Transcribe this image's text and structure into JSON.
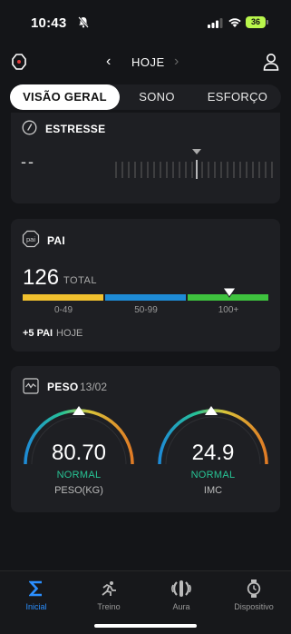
{
  "status_bar": {
    "time": "10:43",
    "battery": "36"
  },
  "header": {
    "date_label": "HOJE"
  },
  "tabs": [
    {
      "label": "VISÃO GERAL",
      "active": true
    },
    {
      "label": "SONO",
      "active": false
    },
    {
      "label": "ESFORÇO",
      "active": false
    }
  ],
  "stress": {
    "title": "ESTRESSE",
    "value": "--"
  },
  "pai": {
    "title": "PAI",
    "value": "126",
    "unit": "TOTAL",
    "level": 0.84,
    "ranges": [
      "0-49",
      "50-99",
      "100+"
    ],
    "range_colors": [
      "#f2c12e",
      "#1e8bd6",
      "#3ec23e"
    ],
    "today_value": "+5 PAI",
    "today_label": "HOJE"
  },
  "peso": {
    "title": "PESO",
    "date": "13/02",
    "weight": {
      "value": "80.70",
      "status": "NORMAL",
      "label": "PESO(KG)"
    },
    "bmi": {
      "value": "24.9",
      "status": "NORMAL",
      "label": "IMC"
    }
  },
  "bottom_nav": [
    {
      "label": "Inicial",
      "icon": "sigma-icon",
      "active": true
    },
    {
      "label": "Treino",
      "icon": "runner-icon",
      "active": false
    },
    {
      "label": "Aura",
      "icon": "aura-icon",
      "active": false
    },
    {
      "label": "Dispositivo",
      "icon": "watch-device-icon",
      "active": false
    }
  ]
}
